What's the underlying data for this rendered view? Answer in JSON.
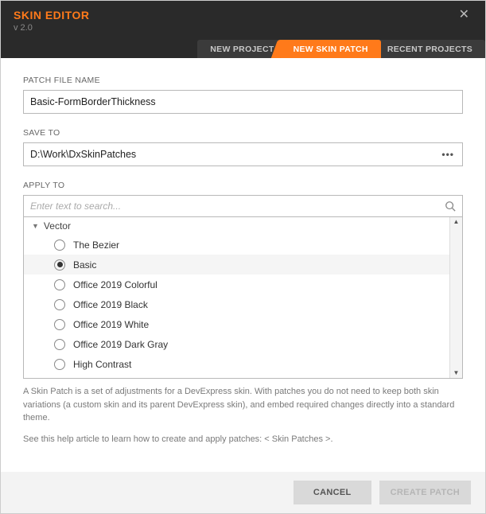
{
  "header": {
    "title": "SKIN EDITOR",
    "version": "v 2.0",
    "tabs": [
      {
        "label": "NEW PROJECT",
        "active": false
      },
      {
        "label": "NEW SKIN PATCH",
        "active": true
      },
      {
        "label": "RECENT PROJECTS",
        "active": false
      }
    ]
  },
  "form": {
    "patch_name_label": "PATCH FILE NAME",
    "patch_name_value": "Basic-FormBorderThickness",
    "save_to_label": "SAVE TO",
    "save_to_value": "D:\\Work\\DxSkinPatches",
    "apply_to_label": "APPLY TO",
    "search_placeholder": "Enter text to search..."
  },
  "skin_list": {
    "group": "Vector",
    "items": [
      {
        "label": "The Bezier",
        "selected": false
      },
      {
        "label": "Basic",
        "selected": true
      },
      {
        "label": "Office 2019 Colorful",
        "selected": false
      },
      {
        "label": "Office 2019 Black",
        "selected": false
      },
      {
        "label": "Office 2019 White",
        "selected": false
      },
      {
        "label": "Office 2019 Dark Gray",
        "selected": false
      },
      {
        "label": "High Contrast",
        "selected": false
      }
    ]
  },
  "help": {
    "p1": "A Skin Patch is a set of adjustments for a DevExpress skin. With patches you do not need to keep both skin variations (a custom skin and its parent DevExpress skin), and embed required changes directly into a standard theme.",
    "p2_prefix": "See this help article to learn how to create and apply patches: ",
    "p2_link": "< Skin Patches >",
    "p2_suffix": "."
  },
  "footer": {
    "cancel_label": "CANCEL",
    "create_label": "CREATE PATCH"
  },
  "colors": {
    "accent": "#ff7a1a",
    "header_bg": "#2a2a2a"
  }
}
